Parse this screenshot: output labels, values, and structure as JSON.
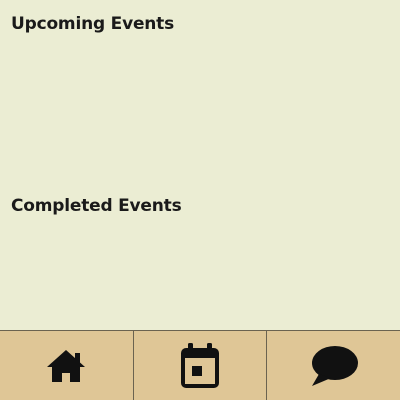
{
  "sections": {
    "upcoming": {
      "title": "Upcoming Events",
      "events": []
    },
    "completed": {
      "title": "Completed Events",
      "events": []
    }
  },
  "nav": {
    "items": [
      {
        "icon": "home-icon"
      },
      {
        "icon": "calendar-icon"
      },
      {
        "icon": "chat-icon"
      }
    ]
  },
  "colors": {
    "background": "#ebedd3",
    "nav_background": "#dfc696",
    "icon": "#111111"
  }
}
